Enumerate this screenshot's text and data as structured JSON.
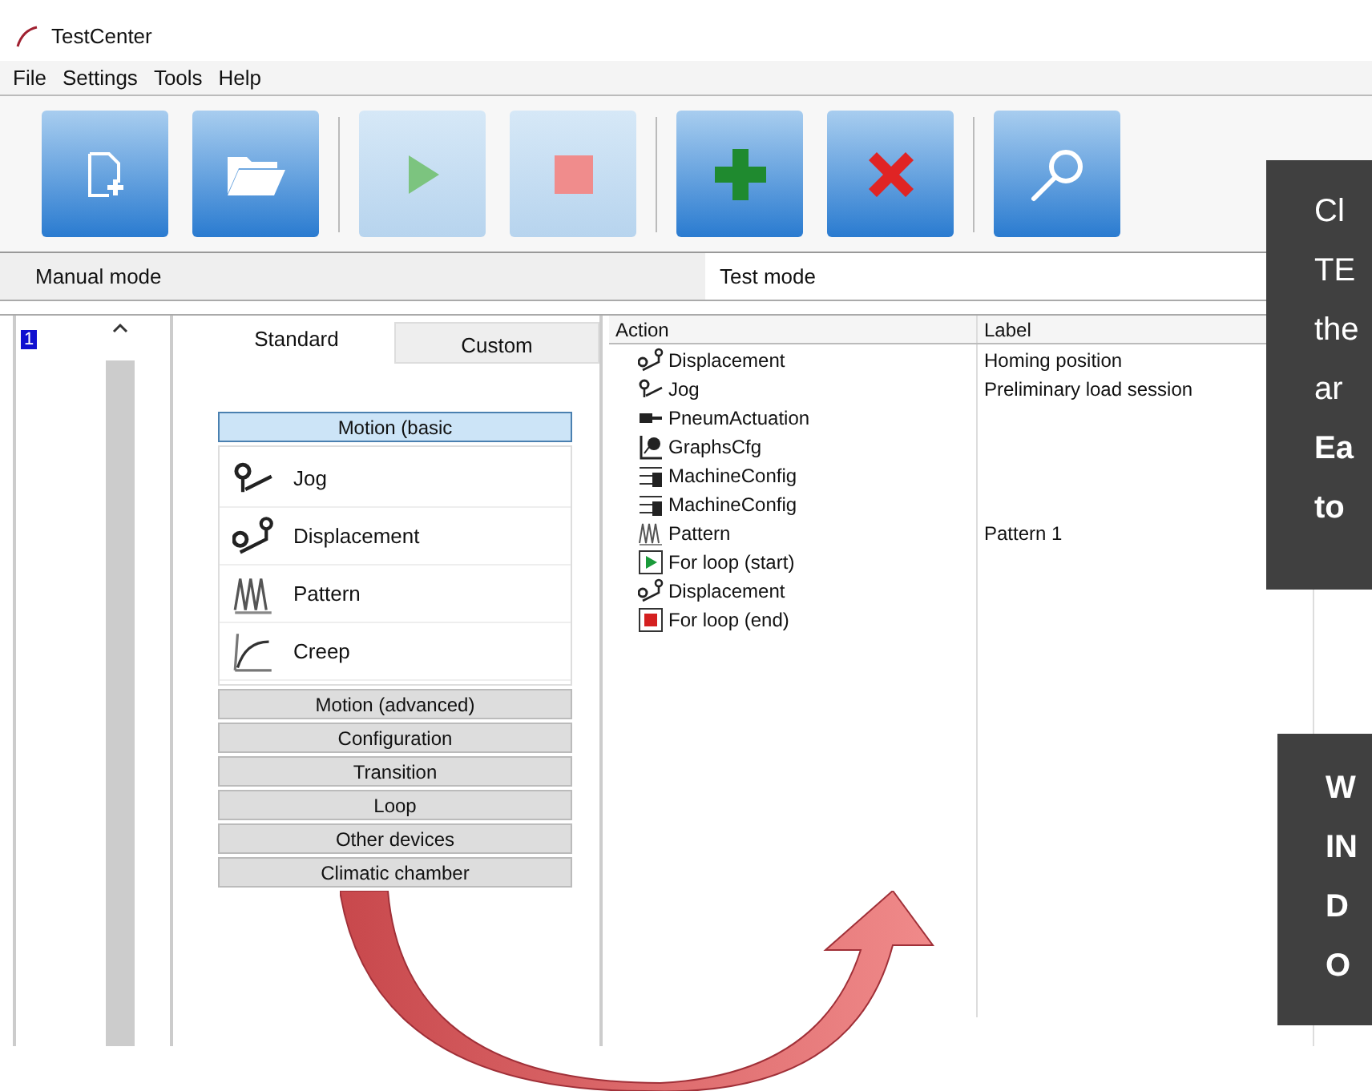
{
  "window": {
    "title": "TestCenter"
  },
  "menu": [
    "File",
    "Settings",
    "Tools",
    "Help"
  ],
  "toolbar": [
    [
      {
        "kind": "new",
        "disabled": false
      },
      {
        "kind": "open",
        "disabled": false
      }
    ],
    [
      {
        "kind": "play",
        "disabled": true
      },
      {
        "kind": "stop",
        "disabled": true
      }
    ],
    [
      {
        "kind": "add",
        "disabled": false
      },
      {
        "kind": "delete",
        "disabled": false
      }
    ],
    [
      {
        "kind": "search",
        "disabled": false
      }
    ]
  ],
  "modes": {
    "left": "Manual mode",
    "right": "Test mode"
  },
  "sequence": {
    "row_number": "1"
  },
  "palette": {
    "tabs": [
      {
        "label": "Standard",
        "selected": true
      },
      {
        "label": "Custom",
        "selected": false
      }
    ],
    "groups": [
      {
        "label": "Motion (basic",
        "expanded": true,
        "items": [
          {
            "kind": "jog",
            "label": "Jog"
          },
          {
            "kind": "displacement",
            "label": "Displacement"
          },
          {
            "kind": "pattern",
            "label": "Pattern"
          },
          {
            "kind": "creep",
            "label": "Creep"
          }
        ]
      },
      {
        "label": "Motion (advanced)",
        "expanded": false
      },
      {
        "label": "Configuration",
        "expanded": false
      },
      {
        "label": "Transition",
        "expanded": false
      },
      {
        "label": "Loop",
        "expanded": false
      },
      {
        "label": "Other devices",
        "expanded": false
      },
      {
        "label": "Climatic chamber",
        "expanded": false
      }
    ]
  },
  "actions": {
    "columns": [
      "Action",
      "Label"
    ],
    "rows": [
      {
        "kind": "displacement",
        "action": "Displacement",
        "label": "Homing position"
      },
      {
        "kind": "jog",
        "action": "Jog",
        "label": "Preliminary load session"
      },
      {
        "kind": "pneumatic",
        "action": "PneumActuation"
      },
      {
        "kind": "graphs",
        "action": "GraphsCfg"
      },
      {
        "kind": "machine",
        "action": "MachineConfig"
      },
      {
        "kind": "machine",
        "action": "MachineConfig"
      },
      {
        "kind": "pattern",
        "action": "Pattern",
        "label": "Pattern 1"
      },
      {
        "kind": "loop-start",
        "action": "For loop (start)"
      },
      {
        "kind": "displacement",
        "action": "Displacement"
      },
      {
        "kind": "loop-end",
        "action": "For loop (end)"
      }
    ]
  },
  "callouts": [
    {
      "lines": [
        {
          "text": "Cl",
          "bold": false
        },
        {
          "text": "TE",
          "bold": false
        },
        {
          "text": "the",
          "bold": false
        },
        {
          "text": "ar",
          "bold": false
        },
        {
          "text": "Ea",
          "bold": true
        },
        {
          "text": "to",
          "bold": true
        }
      ]
    },
    {
      "lines": [
        {
          "text": "W",
          "bold": true
        },
        {
          "text": "IN",
          "bold": true
        },
        {
          "text": "D",
          "bold": true
        },
        {
          "text": "O",
          "bold": true
        }
      ]
    }
  ]
}
